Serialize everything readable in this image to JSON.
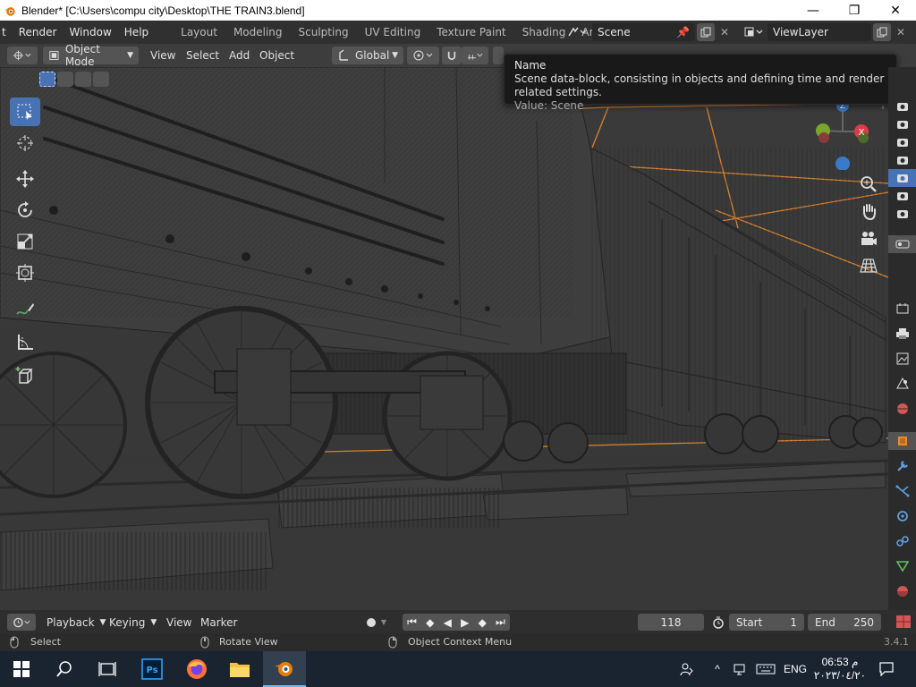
{
  "window": {
    "title": "Blender* [C:\\Users\\compu city\\Desktop\\THE TRAIN3.blend]"
  },
  "top_menu": [
    "t",
    "Render",
    "Window",
    "Help"
  ],
  "workspace_tabs": [
    "Layout",
    "Modeling",
    "Sculpting",
    "UV Editing",
    "Texture Paint",
    "Shading",
    "Animati"
  ],
  "scene_field": "Scene",
  "viewlayer_field": "ViewLayer",
  "header": {
    "mode": "Object Mode",
    "menus": [
      "View",
      "Select",
      "Add",
      "Object"
    ],
    "transform_orientation": "Global"
  },
  "tooltip": {
    "title": "Name",
    "description": "Scene data-block, consisting in objects and defining time and render related settings.",
    "value": "Value: Scene"
  },
  "toolbar_tools": [
    "select-box-tool",
    "cursor-tool",
    "move-tool",
    "rotate-tool",
    "scale-tool",
    "transform-tool",
    "annotate-tool",
    "measure-tool",
    "add-cube-tool"
  ],
  "timeline": {
    "menus": [
      "Playback",
      "Keying",
      "View",
      "Marker"
    ],
    "current_frame": "118",
    "start_label": "Start",
    "start_value": "1",
    "end_label": "End",
    "end_value": "250"
  },
  "status": {
    "left": "Select",
    "middle": "Rotate View",
    "right": "Object Context Menu",
    "version": "3.4.1"
  },
  "taskbar": {
    "language": "ENG",
    "time": "06:53 م",
    "date": "٢٠٢٣/٠٤/٢٠"
  },
  "colors": {
    "accent": "#4772b3",
    "selection_outline": "#e88b2a",
    "axis_x": "#e03a4a",
    "axis_y": "#7aa52f",
    "axis_z": "#3b7ac9"
  }
}
